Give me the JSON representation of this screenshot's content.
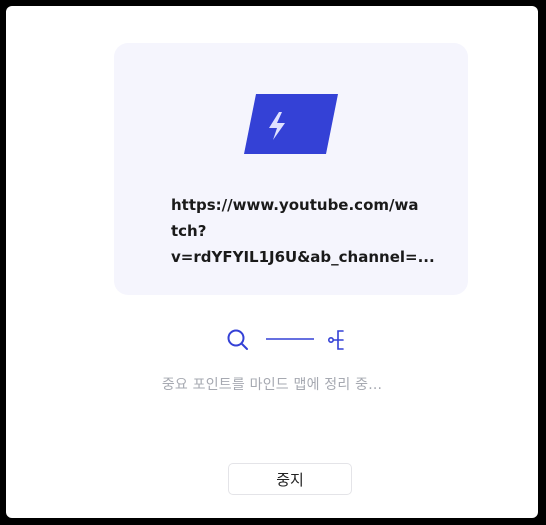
{
  "card": {
    "logo_icon": "lightning-bolt-icon",
    "url_lines": [
      "https://www.youtube.com/wa",
      "tch?",
      "v=rdYFYIL1J6U&ab_channel=..."
    ]
  },
  "progress": {
    "left_icon": "search-icon",
    "right_icon": "mind-map-icon"
  },
  "status_text": "중요 포인트를 마인드 맵에 정리 중...",
  "stop_button_label": "중지",
  "colors": {
    "accent": "#3441d6",
    "card_bg": "#f5f5fd",
    "status_text": "#a6a9b1"
  }
}
